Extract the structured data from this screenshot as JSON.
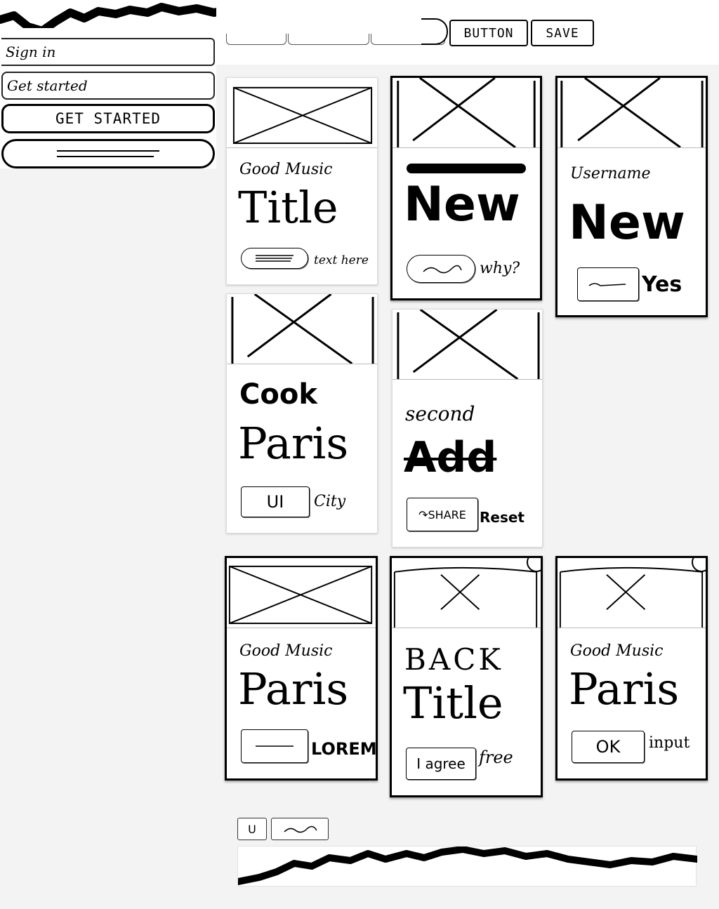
{
  "toolbar": {
    "buttons": [
      {
        "label": "BUTTON"
      },
      {
        "label": "SAVE"
      }
    ]
  },
  "sidebar": {
    "input1_value": "Sign in",
    "input2_value": "Get started",
    "cta_label": "GET STARTED"
  },
  "cards": [
    {
      "subtitle": "Good Music",
      "title": "Title",
      "button_label": "",
      "caption": "text here"
    },
    {
      "subtitle": "",
      "title": "New",
      "button_label": "",
      "caption": "why?"
    },
    {
      "subtitle": "Username",
      "title": "New",
      "button_label": "",
      "caption": "Yes"
    },
    {
      "subtitle": "Cook",
      "title": "Paris",
      "button_label": "UI",
      "caption": "City"
    },
    {
      "subtitle": "second",
      "title": "Add",
      "button_label": "SHARE",
      "caption": "Reset"
    },
    {
      "subtitle": "Good Music",
      "title": "Paris",
      "button_label": "",
      "caption": "LOREM"
    },
    {
      "subtitle": "BACK",
      "title": "Title",
      "button_label": "I agree",
      "caption": "free"
    },
    {
      "subtitle": "Good Music",
      "title": "Paris",
      "button_label": "OK",
      "caption": "input"
    }
  ],
  "bottom": {
    "mini_button_label": "U"
  },
  "icons": {
    "placeholder": "image-placeholder-icon",
    "share": "share-arrow-icon",
    "scribble": "scribble-icon"
  },
  "colors": {
    "ink": "#000000",
    "paper": "#ffffff",
    "canvas": "#f3f3f3"
  }
}
